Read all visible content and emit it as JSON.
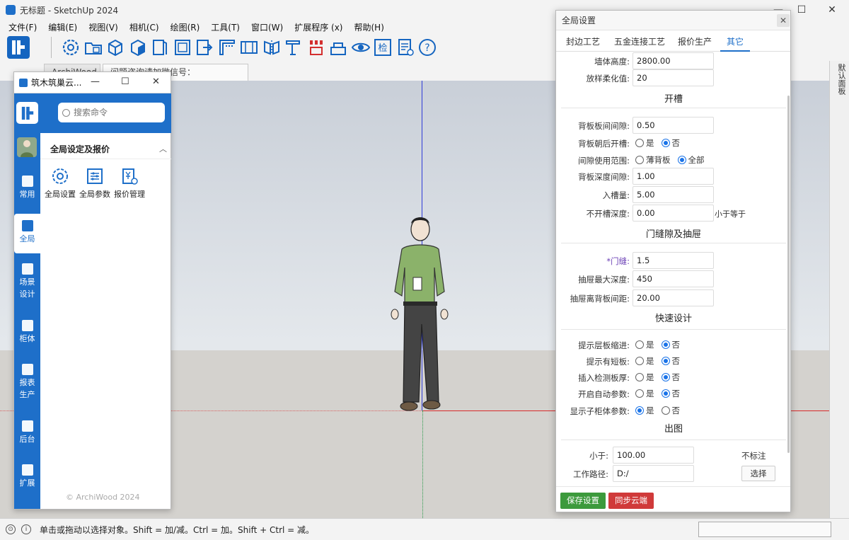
{
  "app": {
    "title": "无标题 - SketchUp 2024",
    "window_controls": [
      "—",
      "☐",
      "✕"
    ]
  },
  "menu": [
    "文件(F)",
    "编辑(E)",
    "视图(V)",
    "相机(C)",
    "绘图(R)",
    "工具(T)",
    "窗口(W)",
    "扩展程序 (x)",
    "帮助(H)"
  ],
  "toolbar": {
    "icons": [
      "gear-icon",
      "folder-box-icon",
      "cube-icon",
      "cube-solid-icon",
      "panel-icon",
      "door-icon",
      "export-icon",
      "frame-icon",
      "wall-icon",
      "mirror-icon",
      "plank-icon",
      "brush-icon",
      "hardware-icon",
      "eye-icon",
      "check-icon",
      "report-icon",
      "help-icon"
    ],
    "check_char": "检",
    "help_char": "?"
  },
  "tabs": [
    "ArchiWood",
    "问题咨询请加微信号：sketchupvray"
  ],
  "right_panel": {
    "label": "默认面板"
  },
  "status": {
    "text": "单击或拖动以选择对象。Shift = 加/减。Ctrl = 加。Shift + Ctrl = 减。"
  },
  "plugin": {
    "title": "筑木筑巢云...",
    "controls": [
      "—",
      "☐",
      "✕"
    ],
    "search_placeholder": "搜索命令",
    "nav": [
      {
        "label": "常用",
        "label2": ""
      },
      {
        "label": "全局",
        "label2": ""
      },
      {
        "label": "场景",
        "label2": "设计"
      },
      {
        "label": "柜体",
        "label2": ""
      },
      {
        "label": "报表",
        "label2": "生产"
      },
      {
        "label": "后台",
        "label2": ""
      },
      {
        "label": "扩展",
        "label2": ""
      }
    ],
    "section_title": "全局设定及报价",
    "functions": [
      "全局设置",
      "全局参数",
      "报价管理"
    ],
    "copyright": "© ArchiWood 2024"
  },
  "dialog": {
    "title": "全局设置",
    "close": "✕",
    "tabs": [
      "封边工艺",
      "五金连接工艺",
      "报价生产",
      "其它"
    ],
    "active_tab": "其它",
    "fields_top": [
      {
        "label": "墙体高度:",
        "value": "2800.00"
      },
      {
        "label": "放样柔化值:",
        "value": "20"
      }
    ],
    "sections": {
      "groove": "开槽",
      "door": "门缝隙及抽屉",
      "quick": "快速设计",
      "output": "出图"
    },
    "groove_fields": {
      "gap": {
        "label": "背板板间间隙:",
        "value": "0.50"
      },
      "back_groove": {
        "label": "背板朝后开槽:",
        "yes": "是",
        "no": "否",
        "selected": "否"
      },
      "range": {
        "label": "间隙使用范围:",
        "a": "薄背板",
        "b": "全部",
        "selected": "全部"
      },
      "depth_gap": {
        "label": "背板深度间隙:",
        "value": "1.00"
      },
      "slot": {
        "label": "入槽量:",
        "value": "5.00"
      },
      "no_groove": {
        "label": "不开槽深度:",
        "value": "0.00",
        "note": "小于等于"
      }
    },
    "door_fields": [
      {
        "label": "*门缝:",
        "value": "1.5",
        "required": true
      },
      {
        "label": "抽屉最大深度:",
        "value": "450"
      },
      {
        "label": "抽屉离背板间距:",
        "value": "20.00"
      }
    ],
    "quick_fields": [
      {
        "label": "提示层板缩进:",
        "yes": "是",
        "no": "否",
        "selected": "否"
      },
      {
        "label": "提示有短板:",
        "yes": "是",
        "no": "否",
        "selected": "否"
      },
      {
        "label": "插入检测板厚:",
        "yes": "是",
        "no": "否",
        "selected": "否"
      },
      {
        "label": "开启自动参数:",
        "yes": "是",
        "no": "否",
        "selected": "否"
      },
      {
        "label": "显示子柜体参数:",
        "yes": "是",
        "no": "否",
        "selected": "是"
      }
    ],
    "output_fields": {
      "less_than": {
        "label": "小于:",
        "value": "100.00",
        "note": "不标注"
      },
      "path": {
        "label": "工作路径:",
        "value": "D:/",
        "button": "选择"
      }
    },
    "buttons": {
      "save": "保存设置",
      "sync": "同步云端"
    }
  },
  "colors": {
    "brand_blue": "#1e6fc9",
    "save_green": "#3c9a3c",
    "sync_red": "#d03a3a",
    "axis_blue": "#2f3bd8",
    "axis_red": "#d82a2a"
  }
}
